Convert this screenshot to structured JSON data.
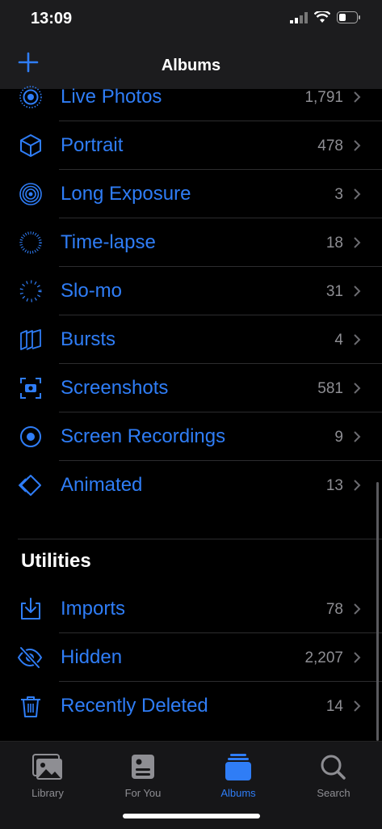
{
  "status": {
    "time": "13:09"
  },
  "nav": {
    "title": "Albums"
  },
  "media_types": [
    {
      "label": "Live Photos",
      "count": "1,791",
      "icon": "live-photo-icon"
    },
    {
      "label": "Portrait",
      "count": "478",
      "icon": "cube-icon"
    },
    {
      "label": "Long Exposure",
      "count": "3",
      "icon": "long-exposure-icon"
    },
    {
      "label": "Time-lapse",
      "count": "18",
      "icon": "timelapse-icon"
    },
    {
      "label": "Slo-mo",
      "count": "31",
      "icon": "slomo-icon"
    },
    {
      "label": "Bursts",
      "count": "4",
      "icon": "bursts-icon"
    },
    {
      "label": "Screenshots",
      "count": "581",
      "icon": "screenshot-icon"
    },
    {
      "label": "Screen Recordings",
      "count": "9",
      "icon": "record-icon"
    },
    {
      "label": "Animated",
      "count": "13",
      "icon": "animated-icon"
    }
  ],
  "utilities": {
    "title": "Utilities",
    "items": [
      {
        "label": "Imports",
        "count": "78",
        "icon": "import-icon"
      },
      {
        "label": "Hidden",
        "count": "2,207",
        "icon": "eye-slash-icon"
      },
      {
        "label": "Recently Deleted",
        "count": "14",
        "icon": "trash-icon"
      }
    ]
  },
  "tabs": [
    {
      "label": "Library",
      "icon": "photo-library-icon"
    },
    {
      "label": "For You",
      "icon": "for-you-icon"
    },
    {
      "label": "Albums",
      "icon": "albums-icon",
      "active": true
    },
    {
      "label": "Search",
      "icon": "search-icon"
    }
  ],
  "colors": {
    "accent": "#2f7df6",
    "background": "#000000",
    "secondary_text": "#8e8e93"
  }
}
